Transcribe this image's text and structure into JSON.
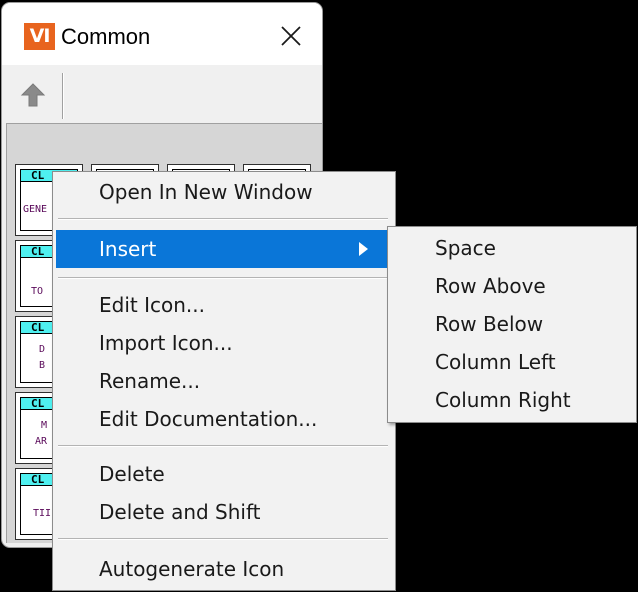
{
  "window": {
    "logo_text": "VI",
    "title": "Common"
  },
  "icons": {
    "close": "close-icon",
    "up": "up-arrow-icon",
    "submenu_arrow": "chevron-right-icon"
  },
  "colors": {
    "highlight": "#0a76d8",
    "vi_banner": "#4ff0f0",
    "logo": "#e8641e"
  },
  "palette": {
    "tiles": [
      {
        "banner": "CL",
        "label": "GENE"
      },
      {
        "banner": "",
        "label": ""
      },
      {
        "banner": "",
        "label": ""
      },
      {
        "banner": "",
        "label": ""
      },
      {
        "banner": "CL",
        "label": "TO"
      },
      {
        "banner": "CL",
        "label": "D"
      },
      {
        "banner": "CL",
        "label": "M"
      },
      {
        "banner": "CL",
        "label": "TII"
      }
    ],
    "tile_sublabels": [
      "B",
      "AR"
    ]
  },
  "context_menu": {
    "items": [
      {
        "label": "Open In New Window"
      },
      {
        "label": "Insert"
      },
      {
        "label": "Edit Icon..."
      },
      {
        "label": "Import Icon..."
      },
      {
        "label": "Rename..."
      },
      {
        "label": "Edit Documentation..."
      },
      {
        "label": "Delete"
      },
      {
        "label": "Delete and Shift"
      },
      {
        "label": "Autogenerate Icon"
      }
    ],
    "highlighted_item": "Insert"
  },
  "insert_submenu": {
    "items": [
      {
        "label": "Space"
      },
      {
        "label": "Row Above"
      },
      {
        "label": "Row Below"
      },
      {
        "label": "Column Left"
      },
      {
        "label": "Column Right"
      }
    ]
  }
}
